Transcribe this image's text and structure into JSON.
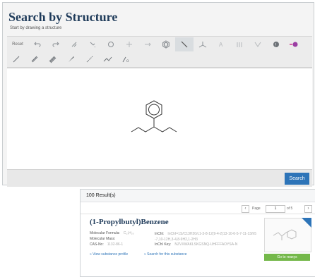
{
  "header": {
    "title": "Search by Structure",
    "subtitle": "Start by drawing a structure"
  },
  "toolbar": {
    "reset_label": "Reset",
    "row1_icons": [
      "undo-icon",
      "redo-icon",
      "clean-icon",
      "charge-icon",
      "ring-icon",
      "plus-icon",
      "arrow-icon",
      "benzene-ring-icon",
      "bond-tool-icon",
      "chain-icon",
      "atom-icon",
      "bond-double-icon",
      "bond-wedge-icon",
      "settings-icon",
      "eraser-icon"
    ],
    "row2_icons": [
      "single-bond-icon",
      "double-bond-icon",
      "triple-bond-icon",
      "wedge-bond-icon",
      "hash-bond-icon",
      "chain-bond-icon",
      "fragment-icon"
    ]
  },
  "actions": {
    "search_label": "Search"
  },
  "results": {
    "count_label": "100 Result(s)",
    "pager": {
      "page_label": "Page",
      "page_value": "1",
      "of_label": "of 5"
    },
    "item": {
      "name": "(1-Propylbutyl)Benzene",
      "formula_label": "Molecular Formula:",
      "formula_value": "C₁₃H₂₀",
      "mass_label": "Molecular Mass:",
      "mass_value": "",
      "cas_label": "CAS-No:",
      "cas_value": "1132-86-1",
      "inchi_label": "InChI:",
      "inchi_value": "InChI=1S/C13H20/c1-3-8-12(9-4-2)13-10-6-5-7-11-13/h5-7,10-12H,3-4,8-9H2,1-2H3",
      "inchikey_label": "InChI Key:",
      "inchikey_value": "NZVXWAKLSKGSNQ-UHFFFAOYSA-N",
      "link_profile": "View substance profile",
      "link_search": "Search for this substance",
      "button_label": "Go to reaxys"
    }
  },
  "colors": {
    "title": "#1f3b5a",
    "accent": "#2d74b8",
    "green": "#74b84a"
  }
}
